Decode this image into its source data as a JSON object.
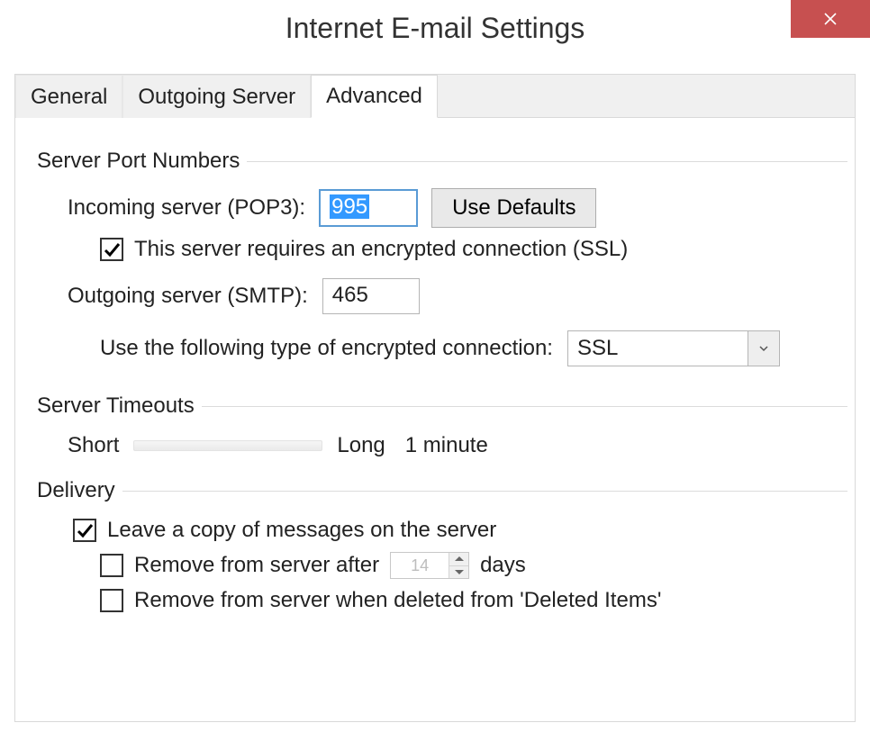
{
  "window": {
    "title": "Internet E-mail Settings"
  },
  "tabs": {
    "general": "General",
    "outgoing": "Outgoing Server",
    "advanced": "Advanced"
  },
  "sections": {
    "port_numbers": "Server Port Numbers",
    "server_timeouts": "Server Timeouts",
    "delivery": "Delivery"
  },
  "ports": {
    "incoming_label": "Incoming server (POP3):",
    "incoming_value": "995",
    "use_defaults_btn": "Use Defaults",
    "ssl_checkbox_label": "This server requires an encrypted connection (SSL)",
    "ssl_checked": true,
    "outgoing_label": "Outgoing server (SMTP):",
    "outgoing_value": "465",
    "enc_type_label": "Use the following type of encrypted connection:",
    "enc_type_value": "SSL"
  },
  "timeouts": {
    "short_label": "Short",
    "long_label": "Long",
    "value_label": "1 minute"
  },
  "delivery": {
    "leave_copy_label": "Leave a copy of messages on the server",
    "leave_copy_checked": true,
    "remove_after_prefix": "Remove from server after",
    "remove_after_days_value": "14",
    "remove_after_suffix": "days",
    "remove_after_checked": false,
    "remove_deleted_label": "Remove from server when deleted from 'Deleted Items'",
    "remove_deleted_checked": false
  }
}
